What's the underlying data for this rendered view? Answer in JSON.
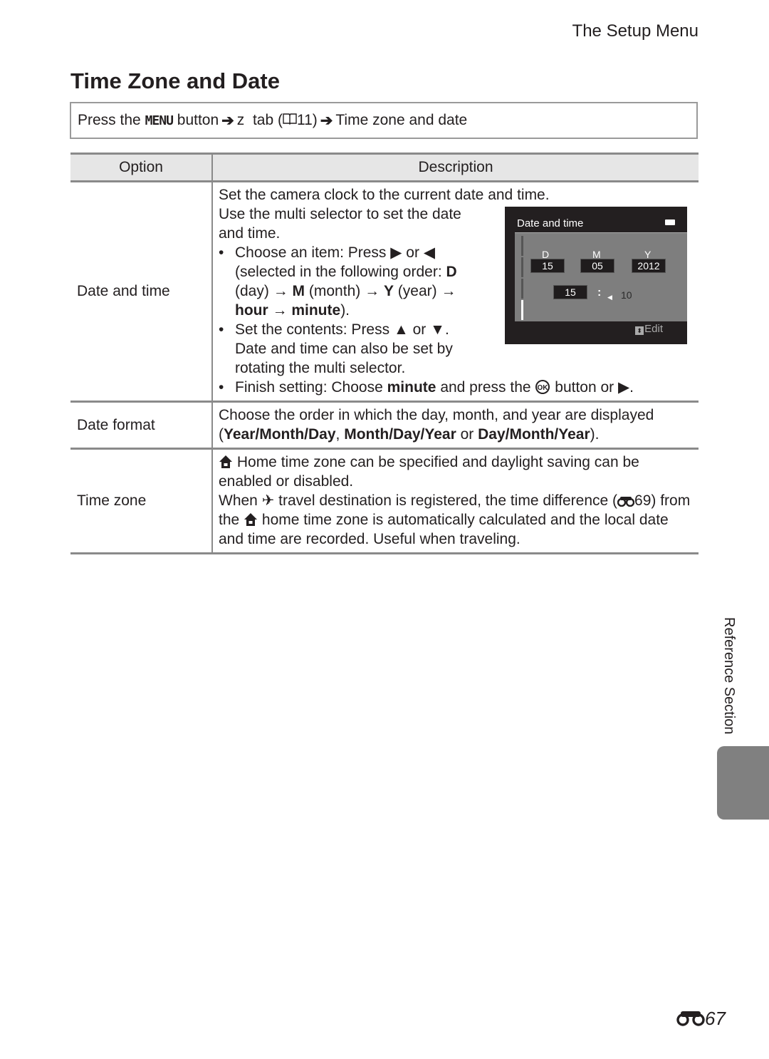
{
  "header": {
    "section": "The Setup Menu",
    "title": "Time Zone and Date"
  },
  "nav": {
    "prefix": "Press the",
    "menu_key": "MENU",
    "button_word": "button",
    "tab_icon": "z",
    "tab_word": "tab (",
    "book_icon": "book-icon",
    "page_ref": "11)",
    "destination": "Time zone and date"
  },
  "table": {
    "headers": {
      "option": "Option",
      "description": "Description"
    },
    "rows": [
      {
        "option": "Date and time",
        "intro1": "Set the camera clock to the current date and time.",
        "intro2": "Use the multi selector to set the date and time.",
        "b1_a": "Choose an item: Press",
        "b1_b": "or",
        "b1_c": "(selected in the following order:",
        "b1_d": "D",
        "b1_e": "(day)",
        "b1_f": "M",
        "b1_g": "(month)",
        "b1_h": "Y",
        "b1_i": "(year)",
        "b1_j": "hour",
        "b1_k": "minute",
        "b1_l": ").",
        "b2_a": "Set the contents: Press",
        "b2_b": "or",
        "b2_c": ". Date and time can also be set by rotating the multi selector.",
        "b3_a": "Finish setting: Choose",
        "b3_b": "minute",
        "b3_c": "and press the",
        "b3_d": "button or",
        "b3_e": "."
      },
      {
        "option": "Date format",
        "text_a": "Choose the order in which the day, month, and year are displayed (",
        "fmt1": "Year/Month/Day",
        "sep1": ", ",
        "fmt2": "Month/Day/Year",
        "sep2": " or ",
        "fmt3": "Day/Month/Year",
        "text_b": ")."
      },
      {
        "option": "Time zone",
        "p1": "Home time zone can be specified and daylight saving can be enabled or disabled.",
        "p2_a": "When",
        "p2_b": "travel destination is registered, the time difference (",
        "p2_ref": "69)",
        "p2_c": "from the",
        "p2_d": "home time zone is automatically calculated and the local date and time are recorded. Useful when traveling."
      }
    ]
  },
  "camera_screen": {
    "title": "Date and time",
    "labels": {
      "d": "D",
      "m": "M",
      "y": "Y"
    },
    "day": "15",
    "month": "05",
    "year": "2012",
    "hour": "15",
    "minute": "10",
    "edit_label": "Edit"
  },
  "sidebar": {
    "label": "Reference Section"
  },
  "footer": {
    "page_number": "67"
  }
}
